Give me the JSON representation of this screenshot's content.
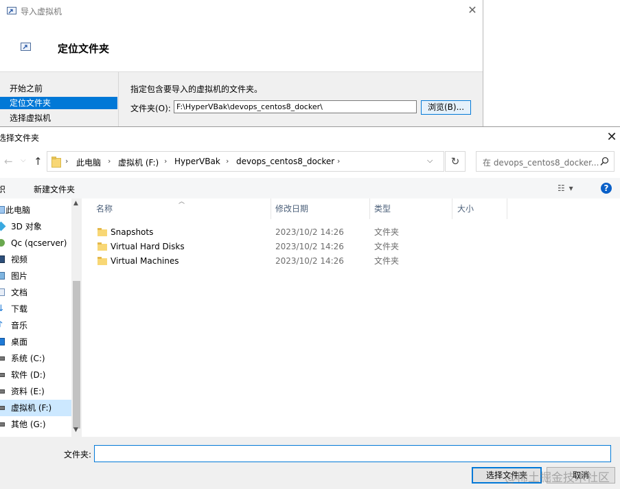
{
  "wizard": {
    "title": "导入虚拟机",
    "close_glyph": "✕",
    "heading": "定位文件夹",
    "steps": [
      "开始之前",
      "定位文件夹",
      "选择虚拟机"
    ],
    "selected_step": 1,
    "description": "指定包含要导入的虚拟机的文件夹。",
    "folder_label": "文件夹(O):",
    "folder_value": "F:\\HyperVBak\\devops_centos8_docker\\",
    "browse_label": "浏览(B)..."
  },
  "dialog": {
    "title": "选择文件夹",
    "close_glyph": "✕",
    "breadcrumb": [
      "此电脑",
      "虚拟机 (F:)",
      "HyperVBak",
      "devops_centos8_docker"
    ],
    "search_placeholder": "在 devops_centos8_docker...",
    "toolbar": {
      "organize_label": "织",
      "new_folder_label": "新建文件夹"
    },
    "nav_items": [
      {
        "label": "此电脑",
        "icon": "computer-icon"
      },
      {
        "label": "3D 对象",
        "icon": "cube-3d-icon"
      },
      {
        "label": "Qc (qcserver)",
        "icon": "network-user-icon"
      },
      {
        "label": "视频",
        "icon": "video-icon"
      },
      {
        "label": "图片",
        "icon": "picture-icon"
      },
      {
        "label": "文档",
        "icon": "document-icon"
      },
      {
        "label": "下载",
        "icon": "download-icon"
      },
      {
        "label": "音乐",
        "icon": "music-icon"
      },
      {
        "label": "桌面",
        "icon": "desktop-icon"
      },
      {
        "label": "系统 (C:)",
        "icon": "drive-icon"
      },
      {
        "label": "软件 (D:)",
        "icon": "drive-icon"
      },
      {
        "label": "资料 (E:)",
        "icon": "drive-icon"
      },
      {
        "label": "虚拟机 (F:)",
        "icon": "drive-icon"
      },
      {
        "label": "其他 (G:)",
        "icon": "drive-icon"
      }
    ],
    "selected_nav": 12,
    "columns": [
      "名称",
      "修改日期",
      "类型",
      "大小"
    ],
    "files": [
      {
        "name": "Snapshots",
        "date": "2023/10/2 14:26",
        "type": "文件夹"
      },
      {
        "name": "Virtual Hard Disks",
        "date": "2023/10/2 14:26",
        "type": "文件夹"
      },
      {
        "name": "Virtual Machines",
        "date": "2023/10/2 14:26",
        "type": "文件夹"
      }
    ],
    "folder_label": "文件夹:",
    "folder_value": "",
    "select_button": "选择文件夹",
    "cancel_button": "取消"
  },
  "watermark": "@稀土掘金技术社区",
  "colors": {
    "accent": "#0078d7",
    "selection": "#cce8ff",
    "folder": "#f8d775"
  }
}
